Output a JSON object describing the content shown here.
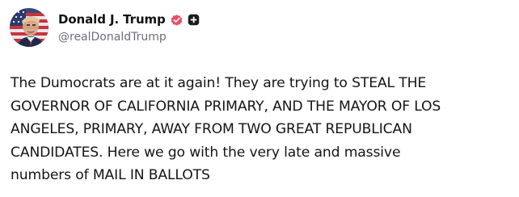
{
  "author": {
    "display_name": "Donald J. Trump",
    "handle": "@realDonaldTrump",
    "avatar_icon": "avatar-flag-portrait",
    "verified_icon": "verified-badge-icon",
    "verified_color": "#e94f6a",
    "plus_icon": "plus-icon",
    "plus_color": "#1c1c1c"
  },
  "post": {
    "text": "The Dumocrats are at it again! They are trying to STEAL THE\nGOVERNOR OF CALIFORNIA PRIMARY, AND THE MAYOR OF LOS\nANGELES, PRIMARY, AWAY FROM TWO GREAT REPUBLICAN\nCANDIDATES. Here we go with the very late and massive\nnumbers of MAIL IN BALLOTS"
  }
}
